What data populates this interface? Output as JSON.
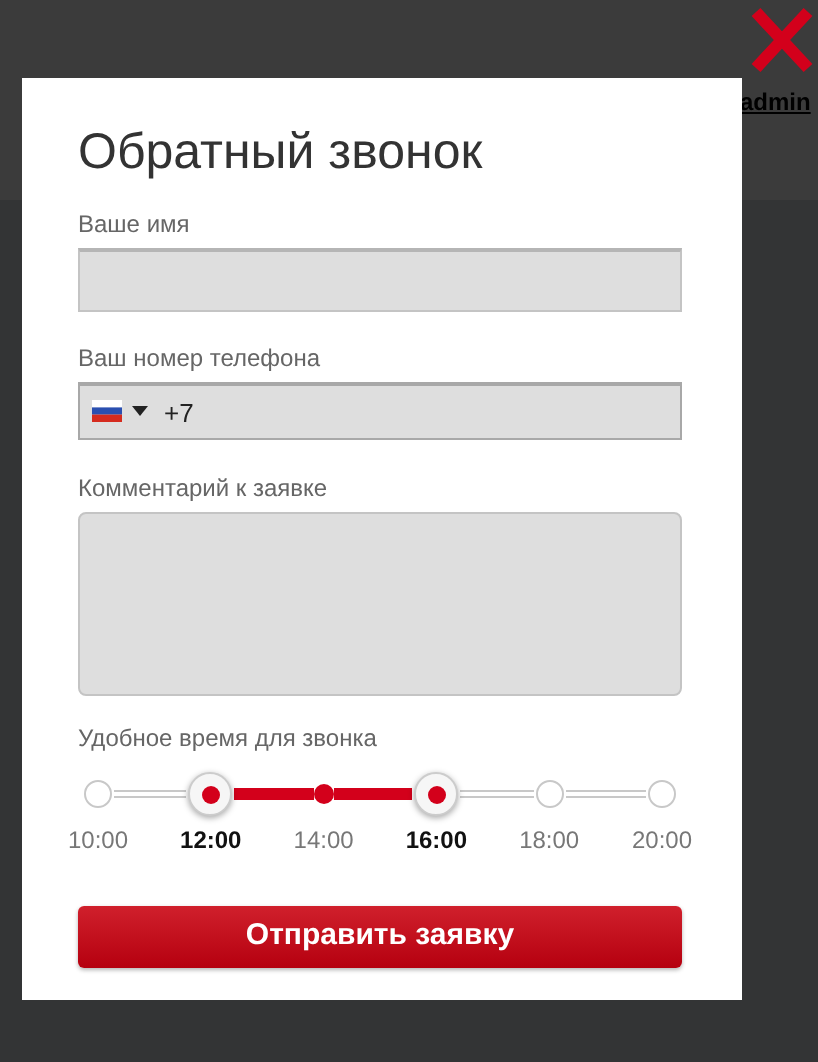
{
  "page": {
    "header_link": "admin"
  },
  "dialog": {
    "title": "Обратный звонок",
    "fields": [
      {
        "kind": "text",
        "label": "Ваше имя"
      },
      {
        "kind": "phone",
        "label": "Ваш номер телефона",
        "value": "+7",
        "focused": true
      },
      {
        "kind": "textarea",
        "label": "Комментарий к заявке"
      }
    ],
    "time": {
      "label": "Удобное время для звонка",
      "ticks": [
        {
          "label": "10:00",
          "selected": false,
          "in_range": false
        },
        {
          "label": "12:00",
          "selected": true,
          "in_range": true
        },
        {
          "label": "14:00",
          "selected": false,
          "in_range": true
        },
        {
          "label": "16:00",
          "selected": true,
          "in_range": true
        },
        {
          "label": "18:00",
          "selected": false,
          "in_range": false
        },
        {
          "label": "20:00",
          "selected": false,
          "in_range": false
        }
      ]
    },
    "submit": "Отправить заявку"
  }
}
